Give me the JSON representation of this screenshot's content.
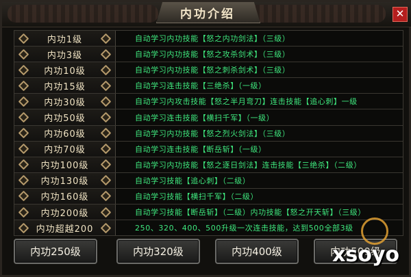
{
  "window": {
    "title": "内功介绍",
    "close_label": "✕"
  },
  "rows": [
    {
      "level": "内功1级",
      "desc": "自动学习内功技能【怒之内功剑法】（三级）"
    },
    {
      "level": "内功3级",
      "desc": "自动学习内功技能【怒之攻杀剑术】（三级）"
    },
    {
      "level": "内功10级",
      "desc": "自动学习内功技能【怒之刺杀剑术】（三级）"
    },
    {
      "level": "内功15级",
      "desc": "自动学习连击技能【三绝杀】（一级）"
    },
    {
      "level": "内功30级",
      "desc": "自动学习内攻击技能【怒之半月弯刀】连击技能【追心刺】一级"
    },
    {
      "level": "内功50级",
      "desc": "自动学习连击技能【横扫千军】（一级）"
    },
    {
      "level": "内功60级",
      "desc": "自动学习内功技能【怒之烈火剑法】（三级）"
    },
    {
      "level": "内功70级",
      "desc": "自动学习连击技能【断岳斩】（一级）"
    },
    {
      "level": "内功100级",
      "desc": "自动学习内功技能【怒之逐日剑法】连击技能【三绝杀】（二级）"
    },
    {
      "level": "内功130级",
      "desc": "自动学习技能【追心刺】（二级）"
    },
    {
      "level": "内功160级",
      "desc": "自动学习技能【横扫千军】（二级）"
    },
    {
      "level": "内功200级",
      "desc": "自动学习技能【断岳斩】（二级）内功技能【怒之开天斩】（三级）"
    },
    {
      "level": "内功超越200",
      "desc": "250、320、400、500升级一次连击技能，达到500全部3级"
    }
  ],
  "buttons": [
    "内功250级",
    "内功320级",
    "内功400级",
    "内功500级"
  ],
  "watermark": "xsoyo",
  "colors": {
    "desc_text": "#3fe87e",
    "level_text": "#f0e3c3",
    "close": "#b41e1e"
  }
}
